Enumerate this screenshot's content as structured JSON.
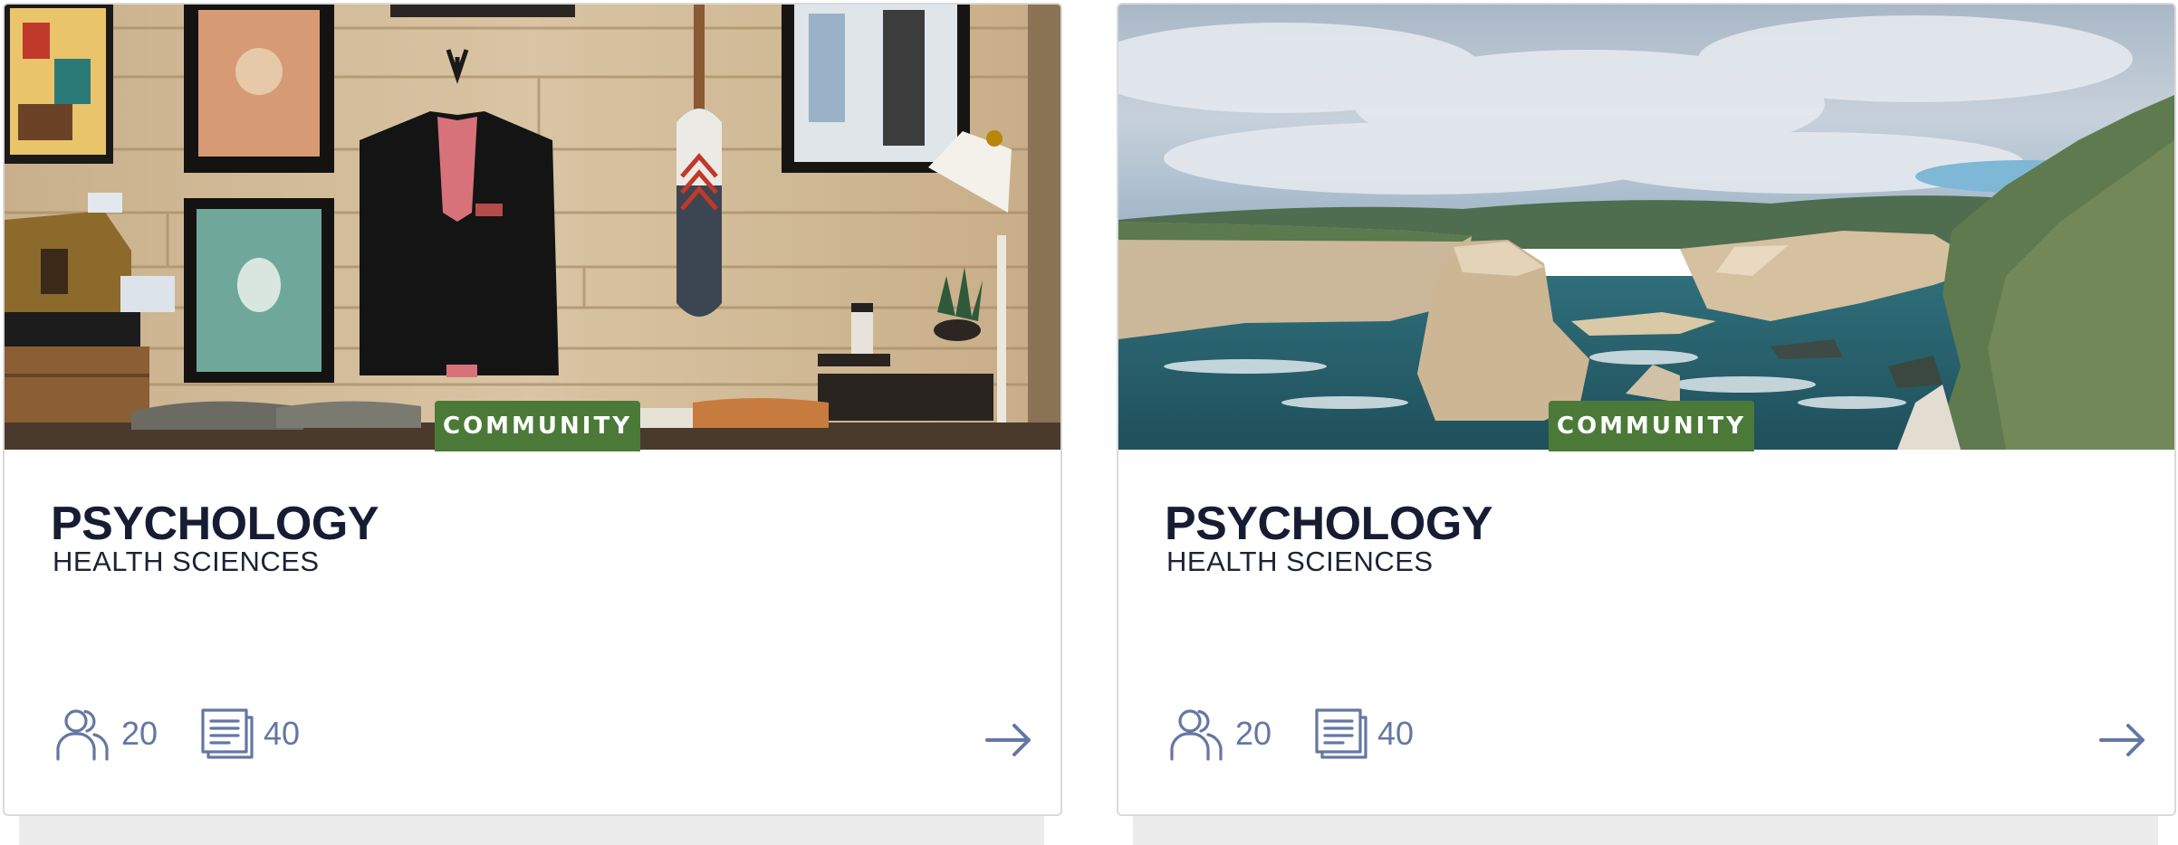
{
  "cards": [
    {
      "badge": "COMMUNITY",
      "title": "PSYCHOLOGY",
      "subtitle": "HEALTH SCIENCES",
      "members_count": "20",
      "posts_count": "40",
      "image": "clothing-shop-wall-photo",
      "members_icon": "users-icon",
      "posts_icon": "document-icon",
      "arrow_icon": "arrow-right-icon"
    },
    {
      "badge": "COMMUNITY",
      "title": "PSYCHOLOGY",
      "subtitle": "HEALTH SCIENCES",
      "members_count": "20",
      "posts_count": "40",
      "image": "coastal-cliffs-photo",
      "members_icon": "users-icon",
      "posts_icon": "document-icon",
      "arrow_icon": "arrow-right-icon"
    }
  ],
  "colors": {
    "badge_bg": "#4b7a38",
    "title": "#161c33",
    "icon": "#6477a4",
    "border": "#dadada"
  }
}
